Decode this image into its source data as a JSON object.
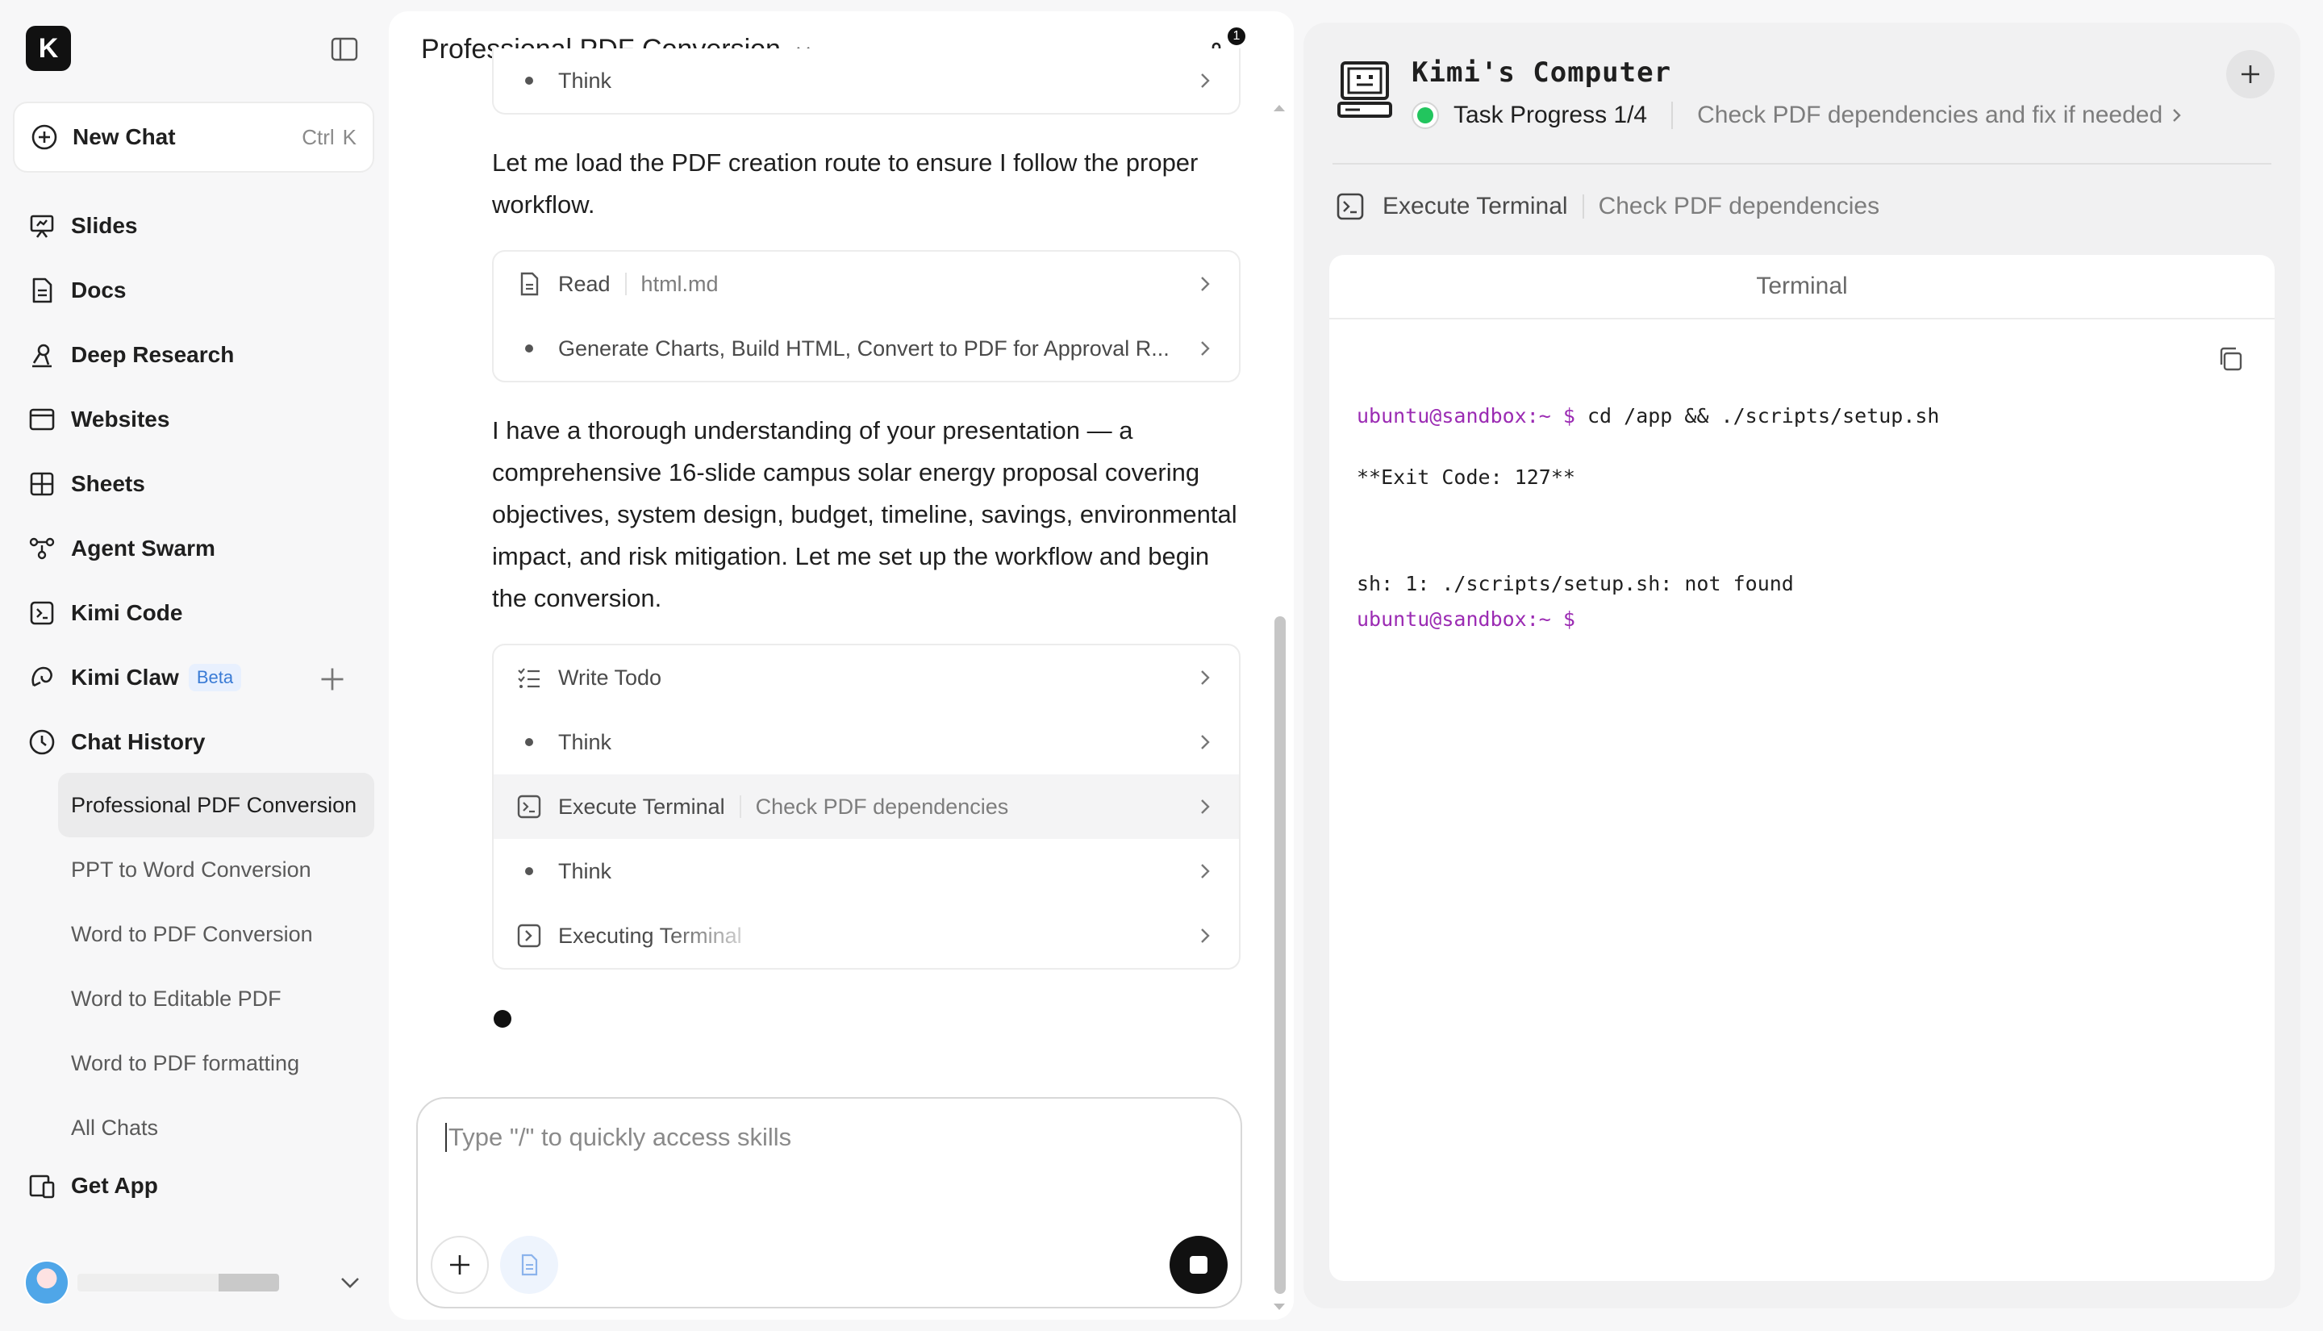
{
  "sidebar": {
    "logo": "K",
    "new_chat": {
      "label": "New Chat",
      "kbd1": "Ctrl",
      "kbd2": "K"
    },
    "nav": [
      {
        "label": "Slides",
        "icon": "slides-icon"
      },
      {
        "label": "Docs",
        "icon": "doc-icon"
      },
      {
        "label": "Deep Research",
        "icon": "research-icon"
      },
      {
        "label": "Websites",
        "icon": "browser-icon"
      },
      {
        "label": "Sheets",
        "icon": "grid-icon"
      },
      {
        "label": "Agent Swarm",
        "icon": "swarm-icon"
      },
      {
        "label": "Kimi Code",
        "icon": "code-icon"
      },
      {
        "label": "Kimi Claw",
        "icon": "claw-icon",
        "badge": "Beta"
      },
      {
        "label": "Chat History",
        "icon": "clock-icon"
      }
    ],
    "history": [
      "Professional PDF Conversion",
      "PPT to Word Conversion",
      "Word to PDF Conversion",
      "Word to Editable PDF",
      "Word to PDF formatting",
      "All Chats"
    ],
    "get_app": "Get App"
  },
  "chat": {
    "title": "Professional PDF Conversion",
    "attachment_count": "1",
    "card1": {
      "rows": [
        {
          "label": "Think"
        }
      ]
    },
    "para1": "Let me load the PDF creation route to ensure I follow the proper workflow.",
    "card2": {
      "rows": [
        {
          "label": "Read",
          "sub": "html.md"
        },
        {
          "label": "Generate Charts, Build HTML, Convert to PDF for Approval R..."
        }
      ]
    },
    "para2": "I have a thorough understanding of your presentation — a comprehensive 16-slide campus solar energy proposal covering objectives, system design, budget, timeline, savings, environmental impact, and risk mitigation. Let me set up the workflow and begin the conversion.",
    "card3": {
      "rows": [
        {
          "label": "Write Todo"
        },
        {
          "label": "Think"
        },
        {
          "label": "Execute Terminal",
          "sub": "Check PDF dependencies"
        },
        {
          "label": "Think"
        },
        {
          "label": "Executing Terminal"
        }
      ]
    },
    "composer": {
      "placeholder": "Type \"/\" to quickly access skills"
    }
  },
  "panel": {
    "title": "Kimi's Computer",
    "progress": "Task Progress 1/4",
    "current_task": "Check PDF dependencies and fix if needed",
    "exec_label": "Execute Terminal",
    "exec_sub": "Check PDF dependencies",
    "terminal": {
      "header": "Terminal",
      "prompt": "ubuntu@sandbox:~ $",
      "command": " cd /app && ./scripts/setup.sh",
      "exit_code": "**Exit Code: 127**",
      "error": "sh: 1: ./scripts/setup.sh: not found",
      "prompt2": "ubuntu@sandbox:~ $"
    }
  },
  "colors": {
    "accent_green": "#22c55e",
    "prompt_purple": "#9b2bb3",
    "beta_blue": "#3a7bd5"
  }
}
